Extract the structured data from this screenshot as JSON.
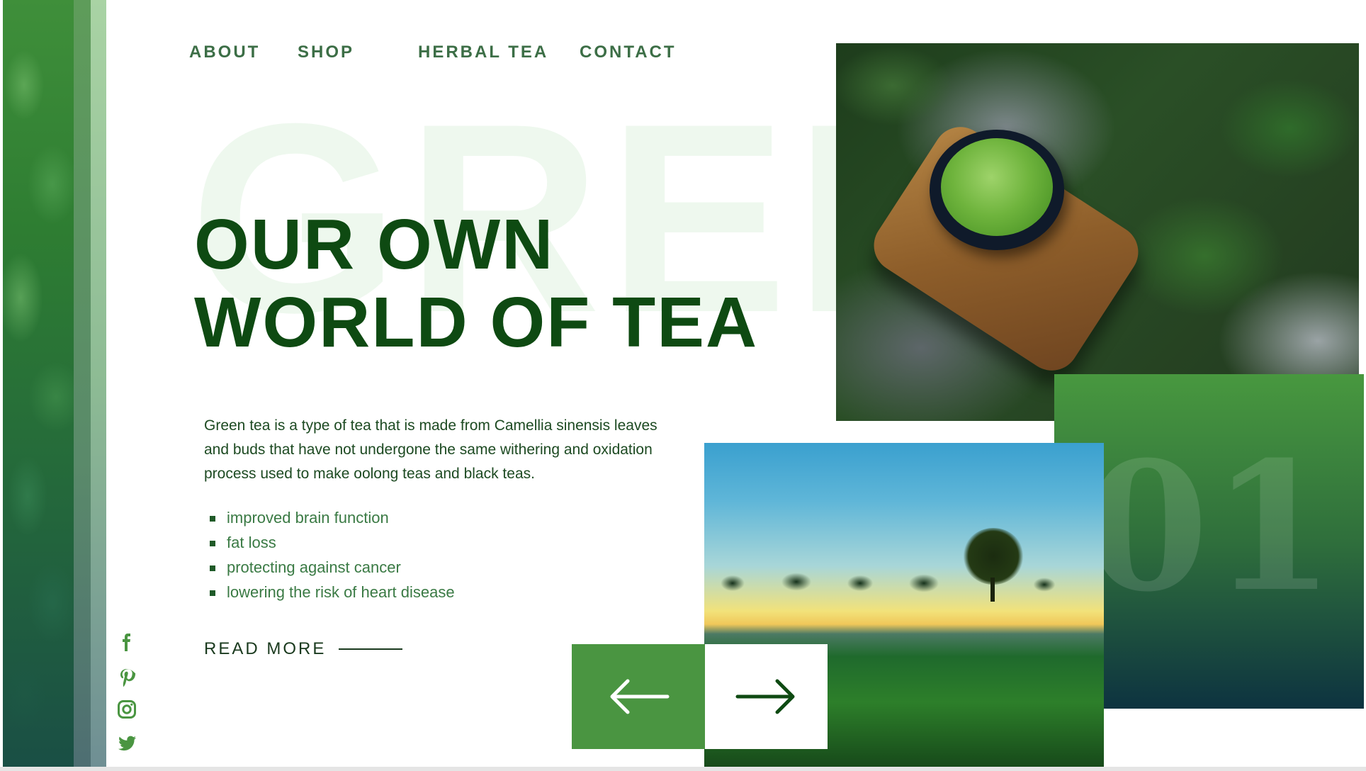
{
  "nav": {
    "items": [
      {
        "label": "ABOUT"
      },
      {
        "label": "SHOP"
      },
      {
        "label": "HERBAL TEA"
      },
      {
        "label": "CONTACT"
      }
    ]
  },
  "hero": {
    "background_word": "GREE",
    "heading_line1": "OUR OWN",
    "heading_line2_normal": "WORLD ",
    "heading_line2_bold": "OF TEA",
    "description": "Green tea is a type of tea that is made from Camellia sinensis leaves and buds that have not undergone the same withering and oxidation process used to make oolong teas and black teas.",
    "benefits": [
      "improved brain function",
      "fat loss",
      "protecting against cancer",
      "lowering the risk of heart disease"
    ],
    "read_more_label": "READ MORE"
  },
  "slider": {
    "number": "01",
    "prev_icon": "arrow-left-icon",
    "next_icon": "arrow-right-icon"
  },
  "social": [
    "facebook-icon",
    "pinterest-icon",
    "instagram-icon",
    "twitter-icon"
  ],
  "colors": {
    "primary_green": "#4a9541",
    "dark_green": "#0e4a12",
    "nav_green": "#3c6e46",
    "text_green": "#3a7a44"
  }
}
